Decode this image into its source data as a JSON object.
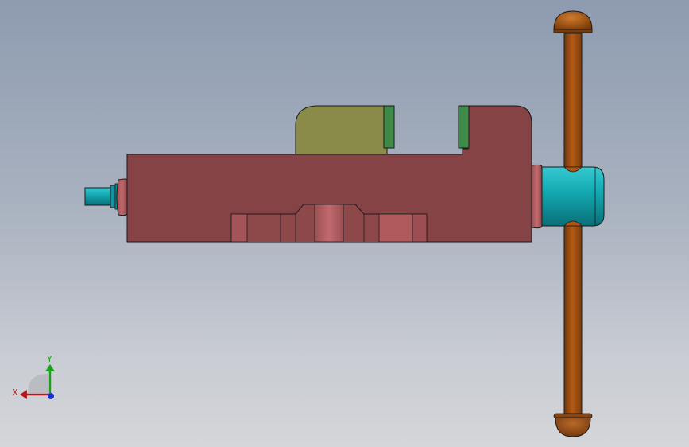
{
  "triad": {
    "x_label": "X",
    "y_label": "Y",
    "x_color": "#c0141c",
    "y_color": "#1aa01a",
    "z_color": "#1a2bd0"
  },
  "colors": {
    "background_top": "#8e9bb0",
    "background_bottom": "#d4d6da",
    "body": "#854345",
    "body_highlight": "#b35a5e",
    "jaw_olive": "#8a8b48",
    "jaw_plate": "#3f8a48",
    "shaft": "#11a4ad",
    "handle": "#a95514"
  }
}
